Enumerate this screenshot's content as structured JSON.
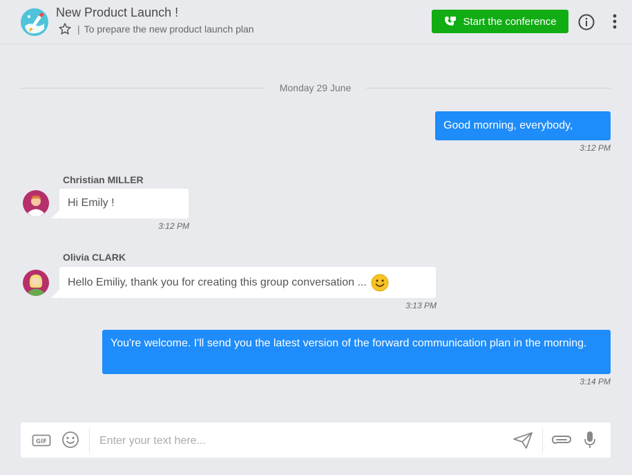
{
  "header": {
    "title": "New Product Launch !",
    "separator": "|",
    "subtitle": "To prepare the new product launch plan",
    "conference_button": "Start the conference",
    "accent_color": "#12ad14"
  },
  "date_divider": "Monday 29 June",
  "messages": [
    {
      "direction": "out",
      "text": "Good morning, everybody,",
      "time": "3:12 PM"
    },
    {
      "direction": "in",
      "sender": "Christian MILLER",
      "text": "Hi Emily !",
      "time": "3:12 PM"
    },
    {
      "direction": "in",
      "sender": "Olivia CLARK",
      "text": "Hello Emiliy, thank you for creating this group conversation ...",
      "emoji": "smiley-icon",
      "time": "3:13 PM"
    },
    {
      "direction": "out",
      "text": "You're welcome. I'll send you the latest version of the forward communication plan in the morning.",
      "time": "3:14 PM"
    }
  ],
  "composer": {
    "placeholder": "Enter your text here...",
    "gif_label": "GIF",
    "icons": [
      "gif-icon",
      "emoji-icon",
      "send-icon",
      "attach-icon",
      "microphone-icon"
    ]
  },
  "colors": {
    "outgoing_bubble": "#1e8cfa",
    "incoming_bubble": "#ffffff",
    "background": "#e9eaee"
  }
}
